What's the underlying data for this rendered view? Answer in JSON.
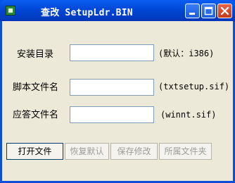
{
  "window": {
    "title": "查改 SetupLdr.BIN"
  },
  "form": {
    "rows": [
      {
        "label": "安装目录",
        "value": "",
        "hint": "(默认：i386)"
      },
      {
        "label": "脚本文件名",
        "value": "",
        "hint": "(txtsetup.sif)"
      },
      {
        "label": "应答文件名",
        "value": "",
        "hint": "(winnt.sif)"
      }
    ]
  },
  "buttons": {
    "open": "打开文件",
    "restore": "恢复默认",
    "save": "保存修改",
    "folder": "所属文件夹"
  }
}
